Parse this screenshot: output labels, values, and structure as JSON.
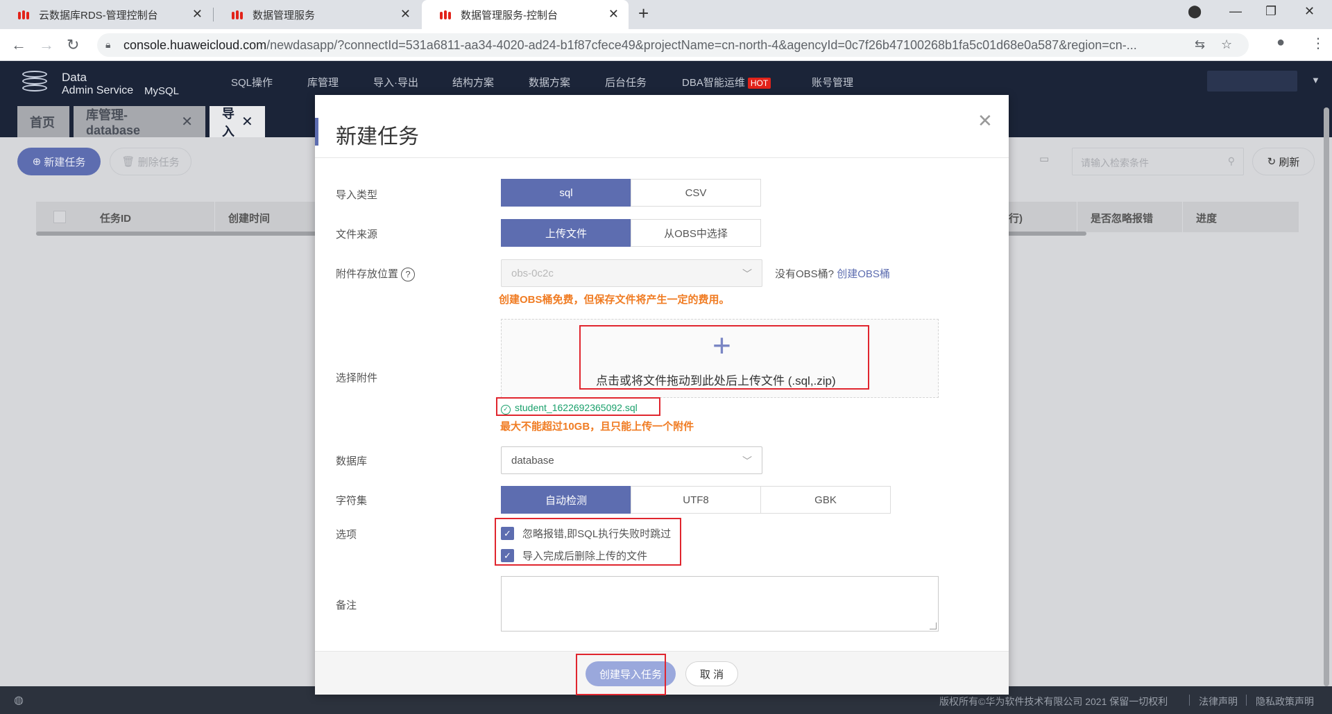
{
  "browser": {
    "tabs": [
      {
        "title": "云数据库RDS-管理控制台"
      },
      {
        "title": "数据管理服务"
      },
      {
        "title": "数据管理服务-控制台"
      }
    ],
    "url_host": "console.huaweicloud.com",
    "url_rest": "/newdasapp/?connectId=531a6811-aa34-4020-ad24-b1f87cfece49&projectName=cn-north-4&agencyId=0c7f26b47100268b1fa5c01d68e0a587&region=cn-..."
  },
  "app": {
    "logo_line1": "Data",
    "logo_line2": "Admin Service",
    "engine": "MySQL",
    "nav": [
      "SQL操作",
      "库管理",
      "导入·导出",
      "结构方案",
      "数据方案",
      "后台任务",
      "DBA智能运维",
      "账号管理"
    ],
    "hot_badge": "HOT"
  },
  "page_tabs": [
    {
      "label": "首页"
    },
    {
      "label": "库管理-database"
    },
    {
      "label": "导入"
    }
  ],
  "toolbar": {
    "new_task": "新建任务",
    "delete_task": "删除任务",
    "search_placeholder": "请输入检索条件",
    "refresh": "刷新"
  },
  "table": {
    "headers_left": [
      "任务ID",
      "创建时间"
    ],
    "headers_right": [
      "行)",
      "是否忽略报错",
      "进度"
    ]
  },
  "modal": {
    "title": "新建任务",
    "import_type": {
      "label": "导入类型",
      "options": [
        "sql",
        "CSV"
      ],
      "selected": "sql"
    },
    "file_source": {
      "label": "文件来源",
      "options": [
        "上传文件",
        "从OBS中选择"
      ],
      "selected": "上传文件"
    },
    "storage": {
      "label": "附件存放位置",
      "value": "obs-0c2c",
      "hint_prefix": "没有OBS桶?",
      "hint_link": "创建OBS桶",
      "warning": "创建OBS桶免费，但保存文件将产生一定的费用。"
    },
    "attachment": {
      "label": "选择附件",
      "drop_text": "点击或将文件拖动到此处后上传文件 (.sql,.zip)",
      "file_name": "student_1622692365092.sql",
      "warning": "最大不能超过10GB，且只能上传一个附件"
    },
    "database": {
      "label": "数据库",
      "value": "database"
    },
    "charset": {
      "label": "字符集",
      "options": [
        "自动检测",
        "UTF8",
        "GBK"
      ],
      "selected": "自动检测"
    },
    "options": {
      "label": "选项",
      "items": [
        "忽略报错,即SQL执行失败时跳过",
        "导入完成后删除上传的文件"
      ]
    },
    "remark": {
      "label": "备注"
    },
    "create_button": "创建导入任务",
    "cancel_button": "取 消"
  },
  "footer": {
    "copyright": "版权所有©华为软件技术有限公司 2021 保留一切权利",
    "legal": "法律声明",
    "privacy": "隐私政策声明"
  }
}
